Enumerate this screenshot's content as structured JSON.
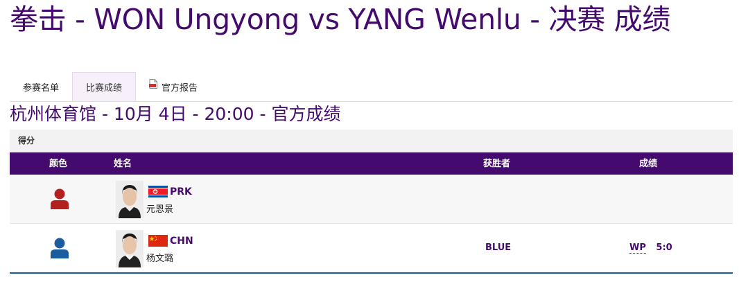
{
  "page": {
    "title": "拳击 - WON Ungyong vs YANG Wenlu - 决赛 成绩",
    "subtitle": "杭州体育馆 - 10月 4日 - 20:00 - 官方成绩"
  },
  "tabs": [
    {
      "label": "参赛名单",
      "active": false
    },
    {
      "label": "比赛成绩",
      "active": true
    },
    {
      "label": "官方报告",
      "active": false,
      "icon": "pdf-icon"
    }
  ],
  "section": {
    "label": "得分"
  },
  "table": {
    "headers": {
      "color": "颜色",
      "name": "姓名",
      "winner": "获胜者",
      "result": "成绩"
    },
    "rows": [
      {
        "corner": "red",
        "icon": "person-icon",
        "icon_color": "#b41f1f",
        "noc": "PRK",
        "flag": "north-korea-flag",
        "name": "元恩景",
        "winner": "",
        "result_code": "",
        "score": ""
      },
      {
        "corner": "blue",
        "icon": "person-icon",
        "icon_color": "#1b5c9e",
        "noc": "CHN",
        "flag": "china-flag",
        "name": "杨文璐",
        "winner": "BLUE",
        "result_code": "WP",
        "score": "5:0"
      }
    ]
  },
  "colors": {
    "brand": "#450a6e",
    "red_corner": "#b41f1f",
    "blue_corner": "#1b5c9e"
  }
}
